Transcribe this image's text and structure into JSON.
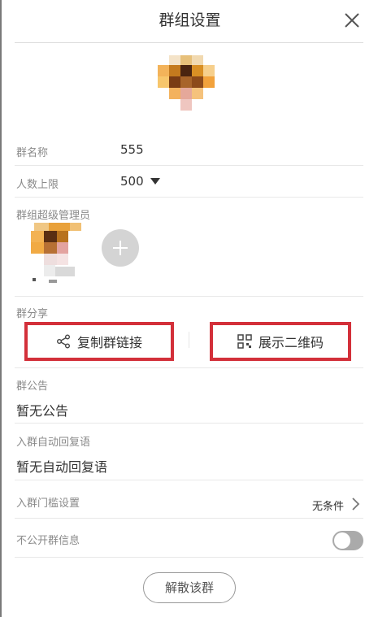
{
  "header": {
    "title": "群组设置",
    "close_icon": "close-icon"
  },
  "group_name": {
    "label": "群名称",
    "value": "555"
  },
  "member_limit": {
    "label": "人数上限",
    "value": "500",
    "dropdown_icon": "caret-down-icon"
  },
  "admins": {
    "label": "群组超级管理员",
    "add_icon": "plus-icon"
  },
  "share": {
    "label": "群分享",
    "copy_link_label": "复制群链接",
    "copy_link_icon": "share-icon",
    "show_qr_label": "展示二维码",
    "show_qr_icon": "qr-code-icon"
  },
  "announcement": {
    "label": "群公告",
    "value": "暂无公告"
  },
  "auto_reply": {
    "label": "入群自动回复语",
    "value": "暂无自动回复语"
  },
  "join_threshold": {
    "label": "入群门槛设置",
    "value": "无条件",
    "icon": "chevron-right-icon"
  },
  "private_info": {
    "label": "不公开群信息",
    "toggle_on": false
  },
  "dissolve_button": {
    "label": "解散该群"
  },
  "colors": {
    "highlight_border": "#d3303a",
    "toggle_off": "#aaaaaa"
  }
}
